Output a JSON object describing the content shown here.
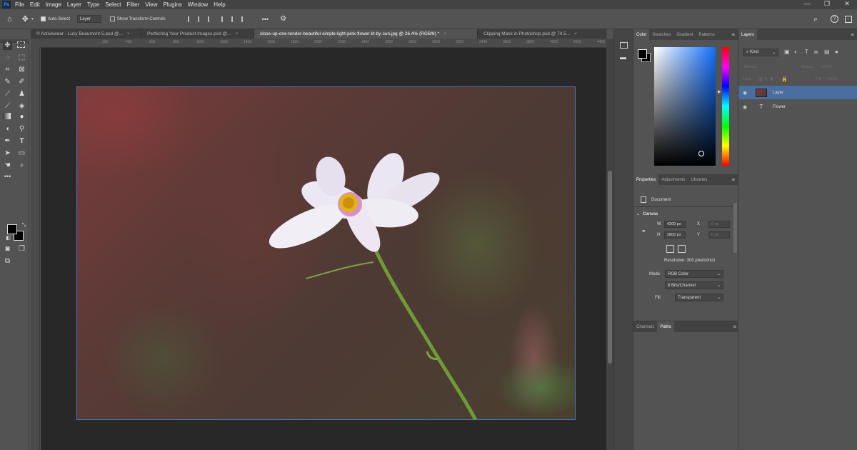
{
  "app": {
    "logo": "Ps"
  },
  "menu": [
    "File",
    "Edit",
    "Image",
    "Layer",
    "Type",
    "Select",
    "Filter",
    "View",
    "Plugins",
    "Window",
    "Help"
  ],
  "window_controls": {
    "minimize": "—",
    "restore": "❐",
    "close": "✕"
  },
  "options_bar": {
    "auto_select_label": "Auto-Select",
    "auto_select_checked": true,
    "layer_select_value": "Layer",
    "show_transform_label": "Show Transform Controls",
    "show_transform_checked": false,
    "more_label": "•••"
  },
  "doc_tabs": [
    {
      "label": "© Activewear - Lucy Beaumont-5.psd @...",
      "active": false
    },
    {
      "label": "Perfecting Your Product Images.psd @...",
      "active": false
    },
    {
      "label": "close-up-one-tender-beautiful-simple-light-pink-flower-lit-by-sun.jpg @ 26.4% (RGB/8) *",
      "active": true
    },
    {
      "label": "Clipping Mask in Photoshop.psd @ 74.5...",
      "active": false
    }
  ],
  "ruler_ticks": [
    "200",
    "400",
    "600",
    "800",
    "1000",
    "1200",
    "1400",
    "1600",
    "1800",
    "2000",
    "2200",
    "2400",
    "2600",
    "2800",
    "3000",
    "3200",
    "3400",
    "3600",
    "3800",
    "4000",
    "4200",
    "4400"
  ],
  "color_panel": {
    "tabs": [
      "Color",
      "Swatches",
      "Gradient",
      "Patterns"
    ],
    "active_tab": "Color",
    "foreground": "#000000",
    "background": "#000000"
  },
  "properties_panel": {
    "tabs": [
      "Properties",
      "Adjustments",
      "Libraries"
    ],
    "active_tab": "Properties",
    "type_label": "Document",
    "section_title": "Canvas",
    "width_label": "W",
    "width_value": "4200 px",
    "height_label": "H",
    "height_value": "2800 px",
    "x_label": "X",
    "x_value": "0 px",
    "y_label": "Y",
    "y_value": "0 px",
    "resolution": "Resolution: 300 pixels/inch",
    "mode_label": "Mode",
    "mode_value": "RGB Color",
    "bits_value": "8 Bits/Channel",
    "fill_label": "Fill",
    "fill_value": "Transparent"
  },
  "channels_panel": {
    "tabs": [
      "Channels",
      "Paths"
    ],
    "active_tab": "Paths"
  },
  "layers_panel": {
    "tab": "Layers",
    "kind_label": "Kind",
    "blend_mode": "Normal",
    "opacity_label": "Opacity:",
    "opacity_value": "100%",
    "lock_label": "Lock:",
    "fill_label": "Fill:",
    "fill_value": "100%",
    "layers": [
      {
        "name": "Layer",
        "type": "image",
        "selected": true,
        "visible": true
      },
      {
        "name": "Flower",
        "type": "text",
        "selected": false,
        "visible": true
      }
    ]
  },
  "colors": {
    "selection": "#4a6ea0",
    "canvas_border": "#4a78b8",
    "petal": "#eae6f2",
    "stem": "#6f9a35"
  },
  "icons": {
    "home": "⌂",
    "move": "✥",
    "lasso": "◌",
    "crop": "⌗",
    "eyedropper": "✎",
    "brush": "🖌",
    "stamp": "⚲",
    "eraser": "◫",
    "gradient": "▦",
    "drop": "💧",
    "dodge": "◐",
    "pen": "✒",
    "type": "T",
    "select_path": "➤",
    "rect": "▭",
    "hand": "✋",
    "zoom": "⚲",
    "eye": "👁",
    "search": "⌕",
    "help": "?",
    "settings": "⚙"
  }
}
